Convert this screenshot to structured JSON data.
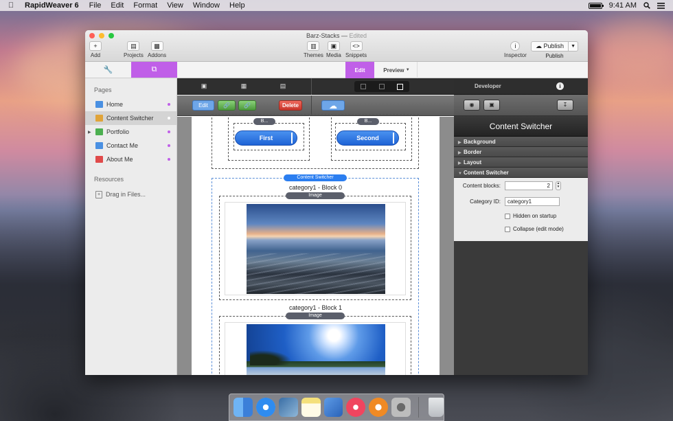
{
  "menubar": {
    "app_name": "RapidWeaver 6",
    "menus": [
      "File",
      "Edit",
      "Format",
      "View",
      "Window",
      "Help"
    ],
    "time": "9:41 AM"
  },
  "window": {
    "title": "Barz-Stacks",
    "edited": "Edited",
    "toolbar": {
      "add_label": "Add",
      "projects_label": "Projects",
      "addons_label": "Addons",
      "themes_label": "Themes",
      "media_label": "Media",
      "snippets_label": "Snippets",
      "inspector_label": "Inspector",
      "publish_button": "Publish",
      "publish_label": "Publish"
    },
    "mode_tabs": {
      "edit": "Edit",
      "preview": "Preview"
    }
  },
  "sidebar": {
    "pages_heading": "Pages",
    "pages": [
      {
        "label": "Home",
        "icon_color": "#4a90e2",
        "dot": true,
        "selected": false
      },
      {
        "label": "Content Switcher",
        "icon_color": "#e0a43a",
        "dot": true,
        "selected": true
      },
      {
        "label": "Portfolio",
        "icon_color": "#4caf50",
        "dot": true,
        "selected": false,
        "has_children": true
      },
      {
        "label": "Contact Me",
        "icon_color": "#4a90e2",
        "dot": true,
        "selected": false
      },
      {
        "label": "About Me",
        "icon_color": "#e04a4a",
        "dot": true,
        "selected": false
      }
    ],
    "resources_heading": "Resources",
    "drag_files": "Drag in Files..."
  },
  "editor": {
    "action_buttons": {
      "edit": "Edit",
      "delete": "Delete"
    },
    "top_buttons": {
      "b1_pill": "B...",
      "b2_pill": "B...",
      "first": "First",
      "second": "Second"
    },
    "content_switcher_label": "Content Switcher",
    "block0_title": "category1 - Block 0",
    "block0_image_label": "Image",
    "block1_title": "category1 - Block 1",
    "block1_image_label": "Image"
  },
  "inspector": {
    "header": "Developer",
    "title": "Content Switcher",
    "sections": [
      "Background",
      "Border",
      "Layout",
      "Content Switcher"
    ],
    "content_blocks_label": "Content blocks:",
    "content_blocks_value": "2",
    "category_id_label": "Category ID:",
    "category_id_value": "category1",
    "hidden_on_startup": "Hidden on startup",
    "collapse_edit_mode": "Collapse (edit mode)"
  },
  "colors": {
    "accent": "#c05fe8",
    "button_blue": "#2b7ef0",
    "delete_red": "#e04040"
  }
}
